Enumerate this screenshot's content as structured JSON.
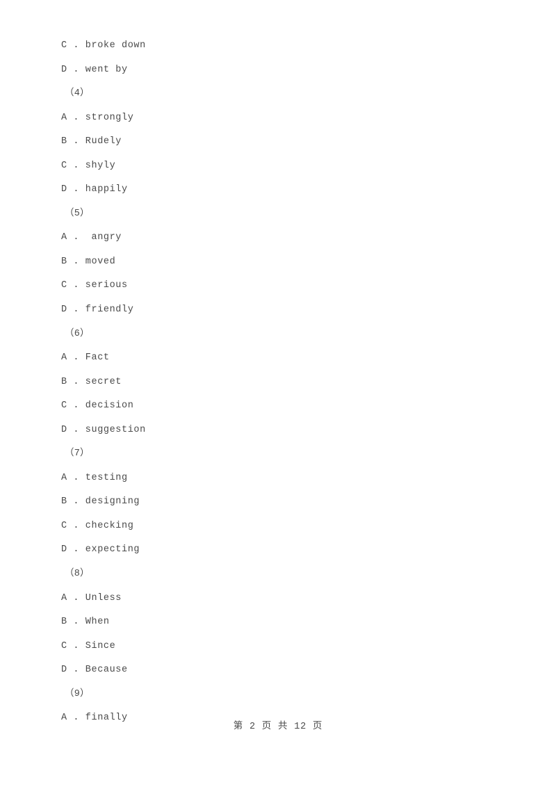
{
  "document": {
    "page_background": "#ffffff",
    "text_color": "#4a4a4a"
  },
  "lines": [
    {
      "kind": "option",
      "text": "C . broke down"
    },
    {
      "kind": "option",
      "text": "D . went by"
    },
    {
      "kind": "qnum",
      "text": "（4）"
    },
    {
      "kind": "option",
      "text": "A . strongly"
    },
    {
      "kind": "option",
      "text": "B . Rudely"
    },
    {
      "kind": "option",
      "text": "C . shyly"
    },
    {
      "kind": "option",
      "text": "D . happily"
    },
    {
      "kind": "qnum",
      "text": "（5）"
    },
    {
      "kind": "option",
      "text": "A .  angry"
    },
    {
      "kind": "option",
      "text": "B . moved"
    },
    {
      "kind": "option",
      "text": "C . serious"
    },
    {
      "kind": "option",
      "text": "D . friendly"
    },
    {
      "kind": "qnum",
      "text": "（6）"
    },
    {
      "kind": "option",
      "text": "A . Fact"
    },
    {
      "kind": "option",
      "text": "B . secret"
    },
    {
      "kind": "option",
      "text": "C . decision"
    },
    {
      "kind": "option",
      "text": "D . suggestion"
    },
    {
      "kind": "qnum",
      "text": "（7）"
    },
    {
      "kind": "option",
      "text": "A . testing"
    },
    {
      "kind": "option",
      "text": "B . designing"
    },
    {
      "kind": "option",
      "text": "C . checking"
    },
    {
      "kind": "option",
      "text": "D . expecting"
    },
    {
      "kind": "qnum",
      "text": "（8）"
    },
    {
      "kind": "option",
      "text": "A . Unless"
    },
    {
      "kind": "option",
      "text": "B . When"
    },
    {
      "kind": "option",
      "text": "C . Since"
    },
    {
      "kind": "option",
      "text": "D . Because"
    },
    {
      "kind": "qnum",
      "text": "（9）"
    },
    {
      "kind": "option",
      "text": "A . finally"
    }
  ],
  "footer": {
    "page_label": "第 2 页 共 12 页",
    "current_page": 2,
    "total_pages": 12
  }
}
